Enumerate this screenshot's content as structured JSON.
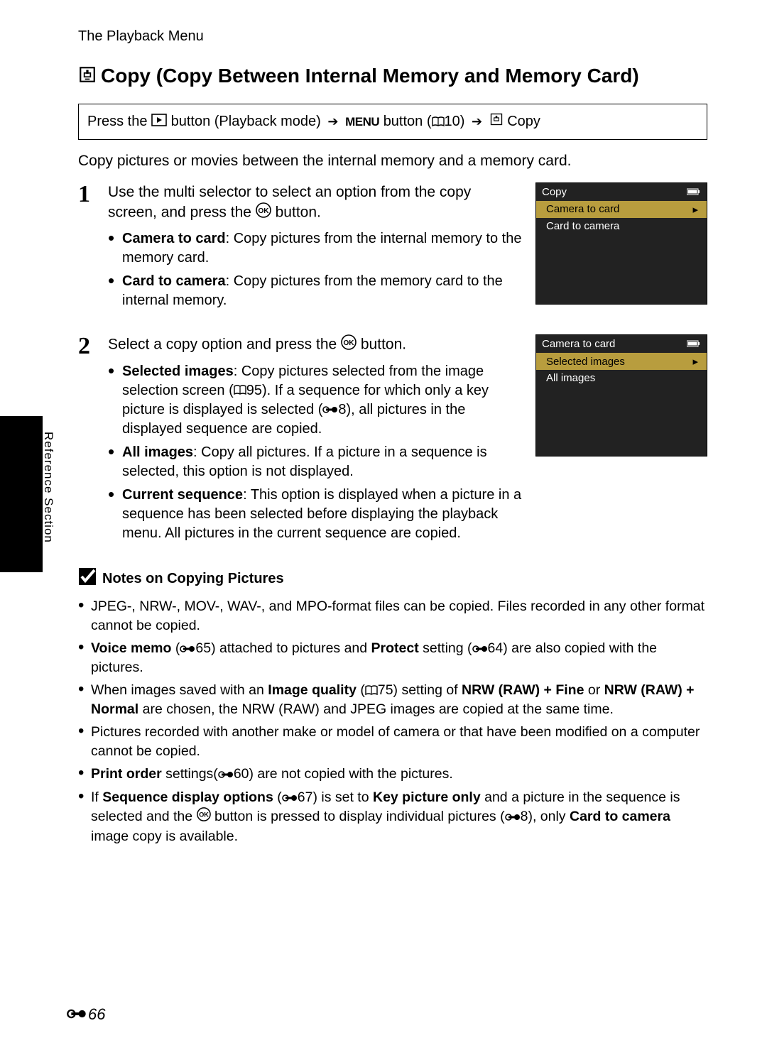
{
  "header": "The Playback Menu",
  "spine_text": "Reference Section",
  "title": "Copy (Copy Between Internal Memory and Memory Card)",
  "nav": {
    "press_the": "Press the",
    "playback_mode": "button (Playback mode)",
    "menu_label": "MENU",
    "button_ref": "button (",
    "ref10": "10)",
    "copy": "Copy"
  },
  "intro": "Copy pictures or movies between the internal memory and a memory card.",
  "step1": {
    "num": "1",
    "head_a": "Use the multi selector to select an option from the copy screen, and press the ",
    "head_b": " button.",
    "items": [
      {
        "term": "Camera to card",
        "desc": ": Copy pictures from the internal memory to the memory card."
      },
      {
        "term": "Card to camera",
        "desc": ": Copy pictures from the memory card to the internal memory."
      }
    ]
  },
  "step2": {
    "num": "2",
    "head_a": "Select a copy option and press the ",
    "head_b": " button.",
    "items": [
      {
        "term": "Selected images",
        "desc_a": ": Copy pictures selected from the image selection screen (",
        "ref": "95",
        "desc_b": "). If a sequence for which only a key picture is displayed is selected (",
        "ref2": "8",
        "desc_c": "), all pictures in the displayed sequence are copied."
      },
      {
        "term": "All images",
        "desc": ": Copy all pictures. If a picture in a sequence is selected, this option is not displayed."
      },
      {
        "term": "Current sequence",
        "desc": ": This option is displayed when a picture in a sequence has been selected before displaying the playback menu. All pictures in the current sequence are copied."
      }
    ]
  },
  "screen1": {
    "title": "Copy",
    "rows": [
      "Camera to card",
      "Card to camera"
    ]
  },
  "screen2": {
    "title": "Camera to card",
    "rows": [
      "Selected images",
      "All images"
    ]
  },
  "notes": {
    "title": "Notes on Copying Pictures",
    "items": [
      {
        "html": "JPEG-, NRW-, MOV-, WAV-, and MPO-format files can be copied. Files recorded in any other format cannot be copied."
      },
      {
        "b1": "Voice memo",
        "ref1": "65",
        "mid1": ") attached to pictures and ",
        "b2": "Protect",
        "mid2": " setting (",
        "ref2": "64",
        "end": ") are also copied with the pictures."
      },
      {
        "pre": "When images saved with an ",
        "b1": "Image quality",
        "mid1": " (",
        "ref1": "75",
        "mid2": ") setting of ",
        "b2": "NRW (RAW) + Fine",
        "mid3": " or ",
        "b3": "NRW (RAW) + Normal",
        "end": " are chosen, the NRW (RAW) and JPEG images are copied at the same time."
      },
      {
        "html": "Pictures recorded with another make or model of camera or that have been modified on a computer cannot be copied."
      },
      {
        "b1": "Print order",
        "mid1": " settings(",
        "ref1": "60",
        "end": ") are not copied with the pictures."
      },
      {
        "pre": "If ",
        "b1": "Sequence display options",
        "mid1": " (",
        "ref1": "67",
        "mid2": ") is set to ",
        "b2": "Key picture only",
        "mid3": " and a picture in the sequence is selected and the ",
        "mid4": " button is pressed to display individual pictures (",
        "ref2": "8",
        "mid5": "), only ",
        "b3": "Card to camera",
        "end": " image copy is available."
      }
    ]
  },
  "page_num": "66"
}
